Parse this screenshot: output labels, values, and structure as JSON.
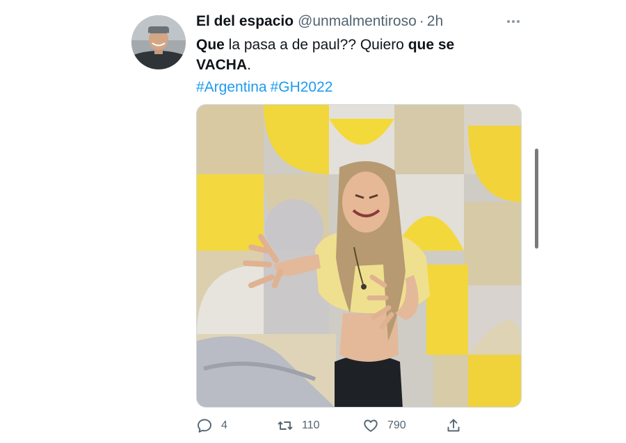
{
  "tweet": {
    "author_name": "El del espacio",
    "handle": "@unmalmentiroso",
    "separator": "·",
    "time": "2h",
    "text_parts": {
      "w1": "Que",
      "w2": " la pasa a de paul?? Quiero ",
      "w3": "que se",
      "w4": "VACHA",
      "w5": "."
    },
    "hashtags": [
      "#Argentina",
      "#GH2022"
    ],
    "media_alt": "Woman gesturing in front of a yellow and grey geometric wall"
  },
  "actions": {
    "reply_icon": "reply-icon",
    "reply_count": "4",
    "retweet_icon": "retweet-icon",
    "retweet_count": "110",
    "like_icon": "heart-icon",
    "like_count": "790",
    "share_icon": "share-icon"
  },
  "colors": {
    "link": "#1d9bf0",
    "muted": "#536471",
    "text": "#0f1419"
  }
}
